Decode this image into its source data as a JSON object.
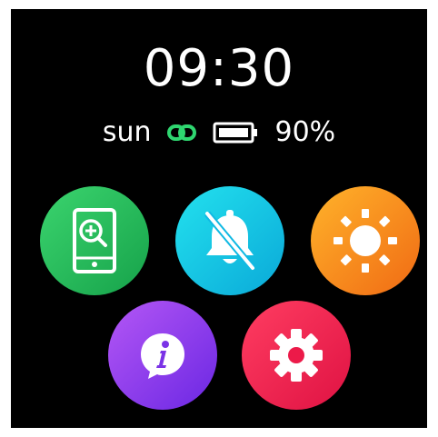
{
  "clock": {
    "time": "09:30"
  },
  "status": {
    "day": "sun",
    "battery_percent": "90%"
  },
  "apps": [
    {
      "name": "find-phone",
      "icon": "phone-search-icon",
      "color": "#22b85a"
    },
    {
      "name": "do-not-disturb",
      "icon": "bell-off-icon",
      "color": "#12c5e6"
    },
    {
      "name": "brightness",
      "icon": "sun-icon",
      "color": "#f7901e"
    },
    {
      "name": "info",
      "icon": "info-icon",
      "color": "#8a3cec"
    },
    {
      "name": "settings",
      "icon": "gear-icon",
      "color": "#f0224f"
    }
  ]
}
